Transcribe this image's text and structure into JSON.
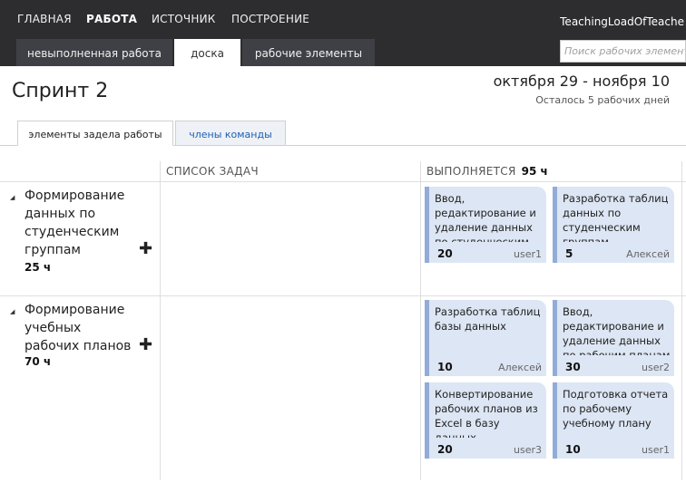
{
  "top_nav": {
    "items": [
      "ГЛАВНАЯ",
      "РАБОТА",
      "ИСТОЧНИК",
      "ПОСТРОЕНИЕ"
    ],
    "active": "РАБОТА",
    "project_name": "TeachingLoadOfTeache"
  },
  "sub_tabs": [
    "невыполненная работа",
    "доска",
    "рабочие элементы"
  ],
  "sub_tab_active": "доска",
  "search": {
    "placeholder": "Поиск рабочих элементов"
  },
  "sprint": {
    "title": "Спринт 2",
    "dates": "октября 29 - ноября 10",
    "remaining": "Осталось 5 рабочих дней"
  },
  "pivots": [
    "элементы задела работы",
    "члены команды"
  ],
  "pivot_active": "элементы задела работы",
  "columns": {
    "todo": {
      "label": "СПИСОК ЗАДАЧ"
    },
    "in_progress": {
      "label": "ВЫПОЛНЯЕТСЯ",
      "hours": "95 ч"
    }
  },
  "rows": [
    {
      "title": "Формирование данных по студенческим группам",
      "hours": "25 ч",
      "cards": [
        {
          "title": "Ввод, редактирование и удаление данных по студенческим группам",
          "hours": "20",
          "owner": "user1"
        },
        {
          "title": "Разработка таблиц данных по студенческим группам",
          "hours": "5",
          "owner": "Алексей"
        }
      ]
    },
    {
      "title": "Формирование учебных рабочих планов",
      "hours": "70 ч",
      "cards": [
        {
          "title": "Разработка таблиц базы данных",
          "hours": "10",
          "owner": "Алексей"
        },
        {
          "title": "Ввод, редактирование и удаление данных по рабочим планам",
          "hours": "30",
          "owner": "user2"
        },
        {
          "title": "Конвертирование рабочих планов из Excel в базу данных",
          "hours": "20",
          "owner": "user3"
        },
        {
          "title": "Подготовка отчета по рабочему учебному плану",
          "hours": "10",
          "owner": "user1"
        }
      ]
    }
  ],
  "colors": {
    "topbar": "#2d2d30",
    "card_bg": "#dde6f4",
    "card_accent": "#91acd6",
    "link": "#1e5fb4"
  }
}
